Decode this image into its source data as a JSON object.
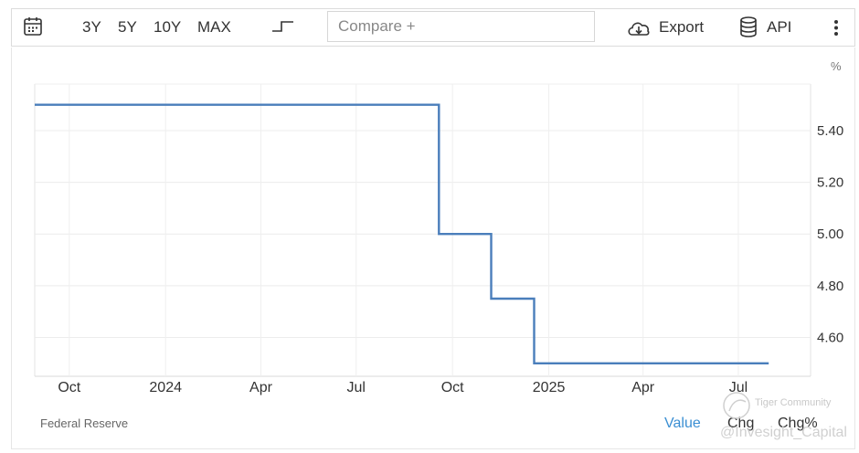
{
  "toolbar": {
    "ranges": [
      "3Y",
      "5Y",
      "10Y",
      "MAX"
    ],
    "compare_placeholder": "Compare +",
    "export_label": "Export",
    "api_label": "API"
  },
  "chart_data": {
    "type": "line",
    "step": true,
    "yunit": "%",
    "ylim": [
      4.45,
      5.58
    ],
    "yticks": [
      4.6,
      4.8,
      5.0,
      5.2,
      5.4
    ],
    "ytick_labels": [
      "4.60",
      "4.80",
      "5.00",
      "5.20",
      "5.40"
    ],
    "xlim": [
      "2023-08-29",
      "2025-09-08"
    ],
    "xticks": [
      {
        "date": "2023-10-01",
        "label": "Oct"
      },
      {
        "date": "2024-01-01",
        "label": "2024"
      },
      {
        "date": "2024-04-01",
        "label": "Apr"
      },
      {
        "date": "2024-07-01",
        "label": "Jul"
      },
      {
        "date": "2024-10-01",
        "label": "Oct"
      },
      {
        "date": "2025-01-01",
        "label": "2025"
      },
      {
        "date": "2025-04-01",
        "label": "Apr"
      },
      {
        "date": "2025-07-01",
        "label": "Jul"
      }
    ],
    "grid": true,
    "color": "#4a7ebb",
    "points": [
      {
        "x": "2023-08-29",
        "y": 5.5
      },
      {
        "x": "2024-09-18",
        "y": 5.0
      },
      {
        "x": "2024-11-07",
        "y": 4.75
      },
      {
        "x": "2024-12-18",
        "y": 4.5
      },
      {
        "x": "2025-07-30",
        "y": 4.5
      }
    ]
  },
  "footer": {
    "source": "Federal Reserve",
    "tabs": [
      "Value",
      "Chg",
      "Chg%"
    ],
    "active_tab": "Value"
  },
  "watermark": {
    "brand": "Tiger Community",
    "handle": "@Invesight_Capital"
  }
}
